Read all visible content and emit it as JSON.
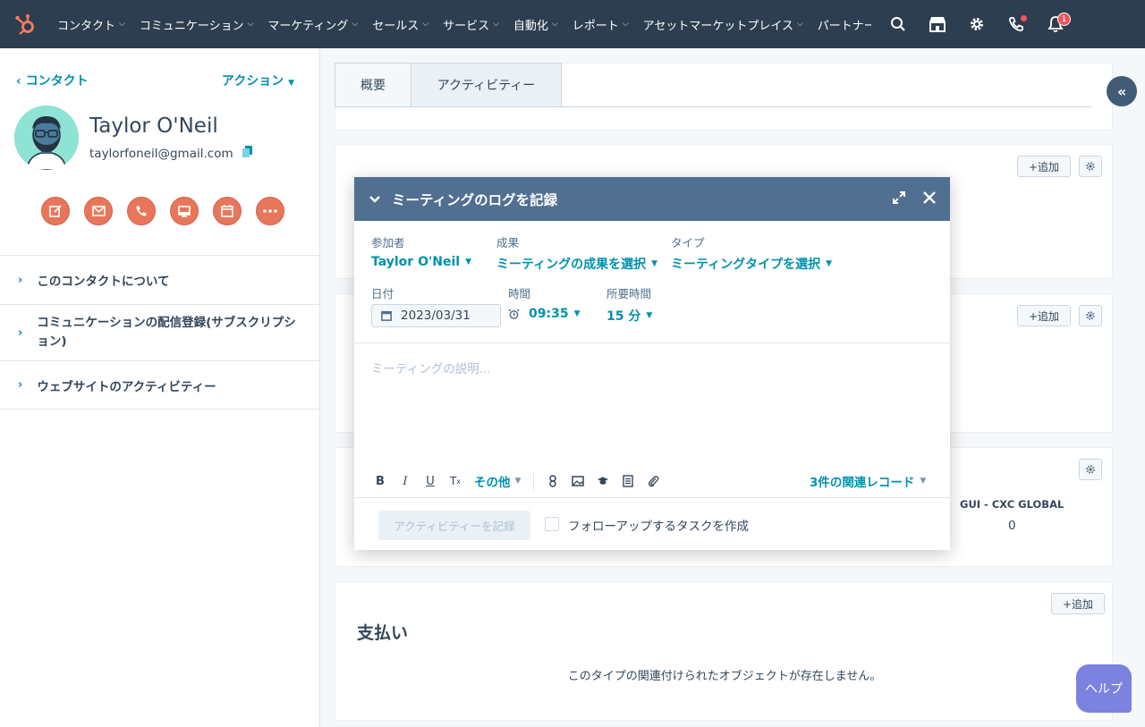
{
  "nav": {
    "items": [
      "コンタクト",
      "コミュニケーション",
      "マーケティング",
      "セールス",
      "サービス",
      "自動化",
      "レポート",
      "アセットマーケットプレイス",
      "パートナー"
    ],
    "notification_count": "1"
  },
  "sidebar": {
    "back_label": "コンタクト",
    "actions_label": "アクション",
    "contact_name": "Taylor O'Neil",
    "contact_email": "taylorfoneil@gmail.com",
    "sections": [
      "このコンタクトについて",
      "コミュニケーションの配信登録(サブスクリプション)",
      "ウェブサイトのアクティビティー"
    ]
  },
  "main": {
    "tabs": [
      "概要",
      "アクティビティー"
    ],
    "add_label": "+追加",
    "column_header": "GUI - CXC GLOBAL",
    "column_value": "0",
    "payments_title": "支払い",
    "payments_empty": "このタイプの関連付けられたオブジェクトが存在しません。"
  },
  "modal": {
    "title": "ミーティングのログを記録",
    "attendees_label": "参加者",
    "attendees_value": "Taylor O'Neil",
    "outcome_label": "成果",
    "outcome_value": "ミーティングの成果を選択",
    "type_label": "タイプ",
    "type_value": "ミーティングタイプを選択",
    "date_label": "日付",
    "date_value": "2023/03/31",
    "time_label": "時間",
    "time_value": "09:35",
    "duration_label": "所要時間",
    "duration_value": "15 分",
    "description_placeholder": "ミーティングの説明...",
    "more_label": "その他",
    "associations_label": "3件の関連レコード",
    "submit_label": "アクティビティーを記録",
    "followup_label": "フォローアップするタスクを作成"
  },
  "help_label": "ヘルプ",
  "colors": {
    "nav_bg": "#2d3e50",
    "accent": "#0091ae",
    "action_orange": "#e8765a",
    "modal_header": "#516f90",
    "brand_orange": "#ff7a59"
  }
}
